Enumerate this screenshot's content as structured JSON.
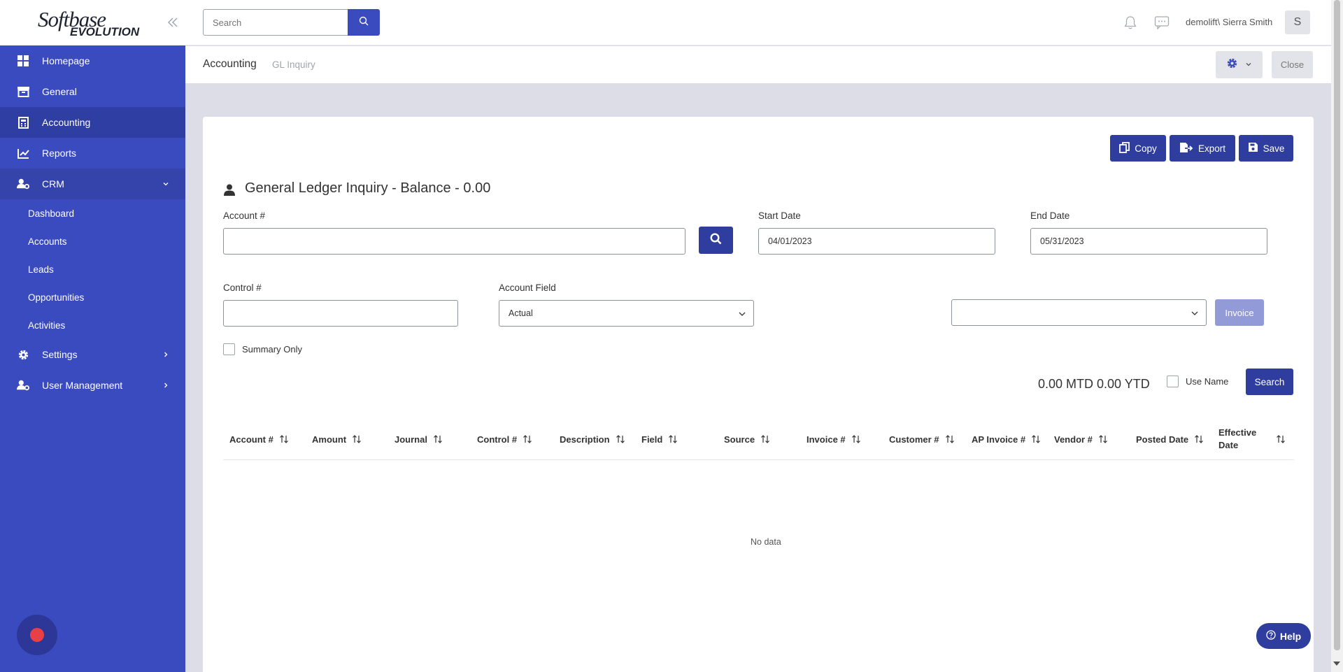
{
  "logo": {
    "line1": "Softbase",
    "line2": "EVOLUTION"
  },
  "sidebar": {
    "items": [
      {
        "label": "Homepage"
      },
      {
        "label": "General"
      },
      {
        "label": "Accounting"
      },
      {
        "label": "Reports"
      },
      {
        "label": "CRM"
      }
    ],
    "crm_sub": [
      {
        "label": "Dashboard"
      },
      {
        "label": "Accounts"
      },
      {
        "label": "Leads"
      },
      {
        "label": "Opportunities"
      },
      {
        "label": "Activities"
      }
    ],
    "bottom_items": [
      {
        "label": "Settings"
      },
      {
        "label": "User Management"
      }
    ]
  },
  "topbar": {
    "search_placeholder": "Search",
    "user": "demolift\\ Sierra Smith",
    "avatar_letter": "S"
  },
  "breadcrumb": {
    "main": "Accounting",
    "sub": "GL Inquiry"
  },
  "header_buttons": {
    "close": "Close"
  },
  "toolbar": {
    "copy": "Copy",
    "export": "Export",
    "save": "Save"
  },
  "form": {
    "title": "General Ledger Inquiry - Balance - 0.00",
    "account_label": "Account #",
    "account_value": "",
    "start_date_label": "Start Date",
    "start_date_value": "04/01/2023",
    "end_date_label": "End Date",
    "end_date_value": "05/31/2023",
    "control_label": "Control #",
    "control_value": "",
    "account_field_label": "Account Field",
    "account_field_value": "Actual",
    "invoice_select_value": "",
    "invoice_button": "Invoice",
    "summary_only": "Summary Only",
    "totals": "0.00 MTD 0.00 YTD",
    "use_name": "Use Name",
    "search_button": "Search"
  },
  "table": {
    "columns": [
      "Account #",
      "Amount",
      "Journal",
      "Control #",
      "Description",
      "Field",
      "Source",
      "Invoice #",
      "Customer #",
      "AP Invoice #",
      "Vendor #",
      "Posted Date"
    ],
    "last_column": [
      "Effective",
      "Date"
    ],
    "empty_text": "No data"
  },
  "help": {
    "label": "Help"
  },
  "colors": {
    "sidebar": "#3a4bbf",
    "primary_button": "#2f3e9e",
    "disabled_button": "#929ad8",
    "record_dot": "#e94046"
  }
}
